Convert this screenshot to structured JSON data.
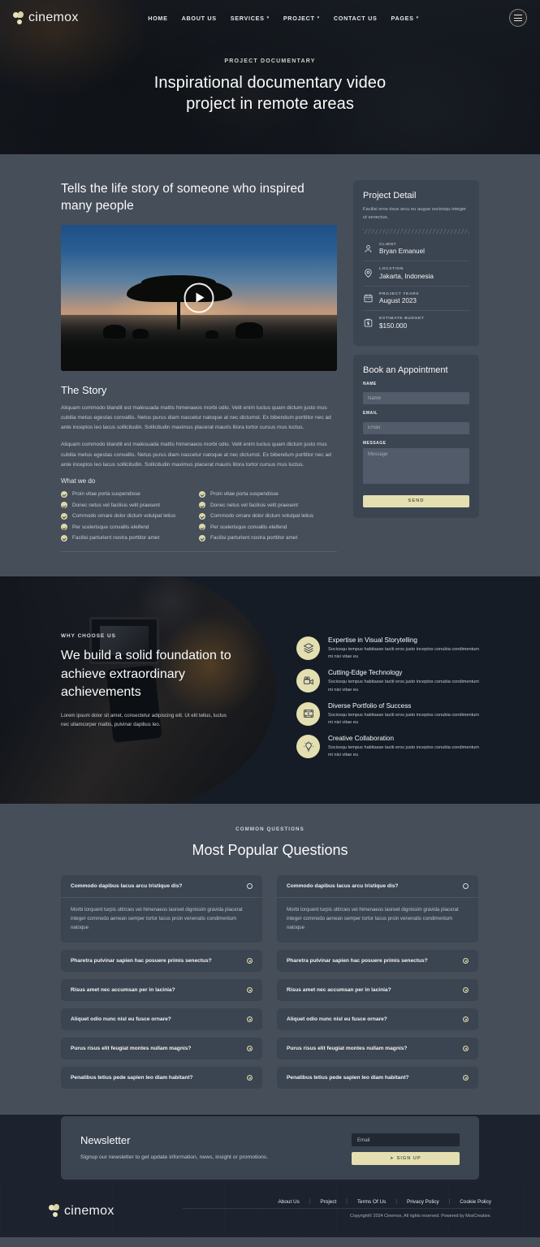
{
  "brand": {
    "name": "cinemox",
    "logo_icon": "cinemox-logo-icon"
  },
  "nav": {
    "items": [
      {
        "label": "HOME",
        "has_caret": false
      },
      {
        "label": "ABOUT US",
        "has_caret": false
      },
      {
        "label": "SERVICES",
        "has_caret": true
      },
      {
        "label": "PROJECT",
        "has_caret": true
      },
      {
        "label": "CONTACT US",
        "has_caret": false
      },
      {
        "label": "PAGES",
        "has_caret": true
      }
    ],
    "menu_button_icon": "hamburger-icon"
  },
  "hero": {
    "eyebrow": "PROJECT DOCUMENTARY",
    "title": "Inspirational documentary video project in remote areas"
  },
  "main": {
    "lead_title": "Tells the life story of someone who inspired many people",
    "video": {
      "play_icon": "play-icon"
    },
    "story_title": "The Story",
    "story_paragraphs": [
      "Aliquam commodo blandit est malesuada mattis himenaeos morbi odio. Velit enim luctus quam dictum justo mus cubilia metus egestas convallis. Netus purus diam nascetur natoque at nec dictumst. Ex bibendum porttitor nec ad ante inceptos leo lacus sollicitudin. Sollicitudin maximus placerat mauris litora tortor cursus mus luctus.",
      "Aliquam commodo blandit est malesuada mattis himenaeos morbi odio. Velit enim luctus quam dictum justo mus cubilia metus egestas convallis. Netus purus diam nascetur natoque at nec dictumst. Ex bibendum porttitor nec ad ante inceptos leo lacus sollicitudin. Sollicitudin maximus placerat mauris litora tortor cursus mus luctus."
    ],
    "what_we_do_title": "What we do",
    "what_we_do_col1": [
      "Proin vitae porta suspendisse",
      "Donec netus vel facilisis velit praesent",
      "Commodo ornare dolor dictum volutpat letius",
      "Per scelerisque convallis eleifend",
      "Facilisi parturient nostra porttitor amet"
    ],
    "what_we_do_col2": [
      "Proin vitae porta suspendisse",
      "Donec netus vel facilisis velit praesent",
      "Commodo ornare dolor dictum volutpat letius",
      "Per scelerisque convallis eleifend",
      "Facilisi parturient nostra porttitor amet"
    ]
  },
  "project_detail": {
    "title": "Project Detail",
    "subtitle": "Facilisi eros risus arcu eu augue sociosqu integer ut senectus.",
    "rows": [
      {
        "icon": "person-icon",
        "label": "CLIENT",
        "value": "Bryan Emanuel"
      },
      {
        "icon": "location-icon",
        "label": "LOCATION",
        "value": "Jakarta, Indonesia"
      },
      {
        "icon": "calendar-icon",
        "label": "PROJECT YEARS",
        "value": "August 2023"
      },
      {
        "icon": "budget-icon",
        "label": "ESTIMATE BUDGET",
        "value": "$150.000"
      }
    ]
  },
  "appointment": {
    "title": "Book an Appointment",
    "name_label": "NAME",
    "name_placeholder": "Name",
    "email_label": "EMAIL",
    "email_placeholder": "Email",
    "message_label": "MESSAGE",
    "message_placeholder": "Message",
    "send_label": "SEND"
  },
  "why": {
    "eyebrow": "WHY CHOOSE US",
    "title": "We build a solid foundation to achieve extraordinary achievements",
    "desc": "Lorem ipsum dolor sit amet, consectetur adipiscing elit. Ut elit tellus, luctus nec ullamcorper mattis, pulvinar dapibus leo.",
    "features": [
      {
        "icon": "layers-icon",
        "title": "Expertise in Visual Storytelling",
        "desc": "Sociosqu tempus habitasse taciti eros justo inceptos conubia condimentum mi nisi vitae eu"
      },
      {
        "icon": "movie-camera-icon",
        "title": "Cutting-Edge Technology",
        "desc": "Sociosqu tempus habitasse taciti eros justo inceptos conubia condimentum mi nisi vitae eu"
      },
      {
        "icon": "film-strip-icon",
        "title": "Diverse Portfolio of Success",
        "desc": "Sociosqu tempus habitasse taciti eros justo inceptos conubia condimentum mi nisi vitae eu"
      },
      {
        "icon": "lightbulb-icon",
        "title": "Creative Collaboration",
        "desc": "Sociosqu tempus habitasse taciti eros justo inceptos conubia condimentum mi nisi vitae eu"
      }
    ]
  },
  "faq": {
    "eyebrow": "COMMON QUESTIONS",
    "heading": "Most Popular Questions",
    "answer_text": "Morbi torquent turpis ultricies vel himenaeos laoreet dignissim gravida placerat integer commodo aenean semper tortor lacus proin venenatis condimentum natoque",
    "col1": [
      {
        "q": "Commodo dapibus lacus arcu tristique dis?",
        "open": true
      },
      {
        "q": "Pharetra pulvinar sapien hac posuere primis senectus?",
        "open": false
      },
      {
        "q": "Risus amet nec accumsan per in lacinia?",
        "open": false
      },
      {
        "q": "Aliquet odio nunc nisl eu fusce ornare?",
        "open": false
      },
      {
        "q": "Purus risus elit feugiat montes nullam magnis?",
        "open": false
      },
      {
        "q": "Penatibus letius pede sapien leo diam habitant?",
        "open": false
      }
    ],
    "col2": [
      {
        "q": "Commodo dapibus lacus arcu tristique dis?",
        "open": true
      },
      {
        "q": "Pharetra pulvinar sapien hac posuere primis senectus?",
        "open": false
      },
      {
        "q": "Risus amet nec accumsan per in lacinia?",
        "open": false
      },
      {
        "q": "Aliquet odio nunc nisl eu fusce ornare?",
        "open": false
      },
      {
        "q": "Purus risus elit feugiat montes nullam magnis?",
        "open": false
      },
      {
        "q": "Penatibus letius pede sapien leo diam habitant?",
        "open": false
      }
    ]
  },
  "newsletter": {
    "title": "Newsletter",
    "desc": "Signup our newsletter to get update information, news, insight or promotions.",
    "email_placeholder": "Email",
    "button_label": "SIGN UP",
    "button_icon": "arrow-icon"
  },
  "footer": {
    "links": [
      "About Us",
      "Project",
      "Terms Of Us",
      "Privacy Policy",
      "Cookie Policy"
    ],
    "copyright": "Copyright© 2024 Cinemox, All rights reserved. Powered by MoxCreative."
  },
  "colors": {
    "accent": "#e4dfb0",
    "page_bg": "#464e5a",
    "card_bg": "#3b4451",
    "dark_bg": "#1c232e"
  }
}
